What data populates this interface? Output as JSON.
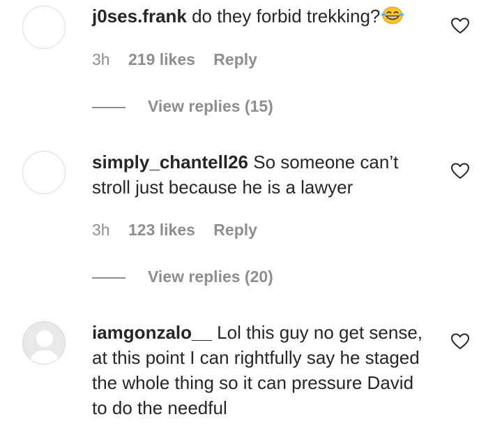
{
  "comments": [
    {
      "username": "j0ses.frank",
      "text": " do they forbid trekking?",
      "emoji": "face-with-tears-of-joy",
      "time": "3h",
      "likes": "219 likes",
      "reply_label": "Reply",
      "view_replies": "View replies (15)",
      "avatar": "blank"
    },
    {
      "username": "simply_chantell26",
      "text": " So someone can’t stroll just because he is a lawyer",
      "time": "3h",
      "likes": "123 likes",
      "reply_label": "Reply",
      "view_replies": "View replies (20)",
      "avatar": "blank"
    },
    {
      "username": "iamgonzalo__",
      "text": " Lol this guy no get sense, at this point I can rightfully say he staged the whole thing so it can pressure David to do the needful",
      "avatar": "default-silhouette"
    }
  ],
  "icons": {
    "like": "heart-outline-icon"
  },
  "colors": {
    "text": "#262626",
    "secondary": "#8e8e8e",
    "avatar_border": "#dbdbdb"
  }
}
